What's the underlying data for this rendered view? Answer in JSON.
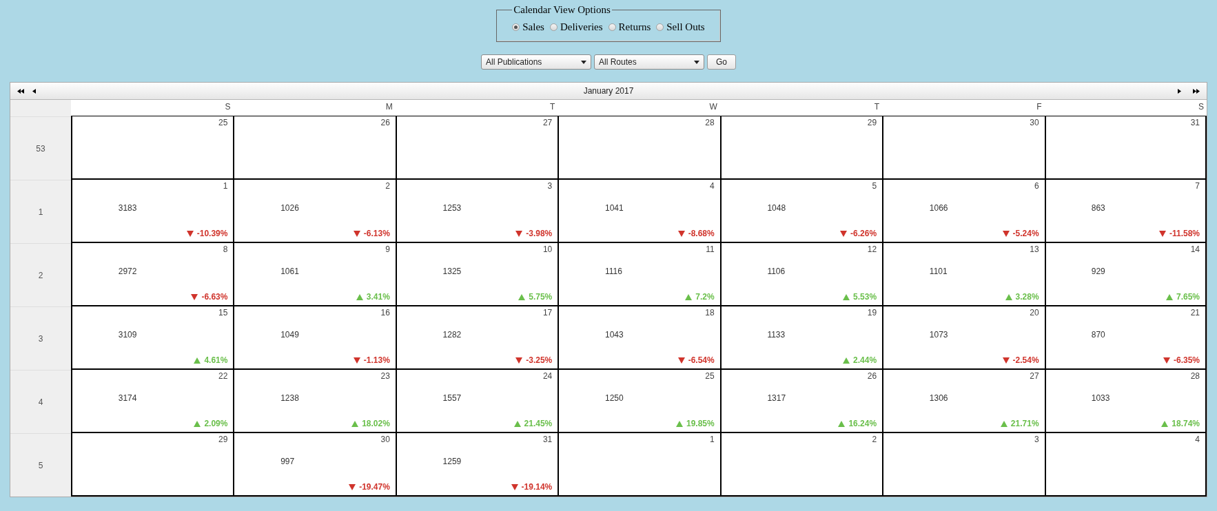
{
  "view_options": {
    "legend": "Calendar View Options",
    "options": [
      {
        "label": "Sales",
        "selected": true
      },
      {
        "label": "Deliveries",
        "selected": false
      },
      {
        "label": "Returns",
        "selected": false
      },
      {
        "label": "Sell Outs",
        "selected": false
      }
    ]
  },
  "filters": {
    "publication": "All Publications",
    "route": "All Routes",
    "go": "Go"
  },
  "calendar": {
    "title": "January 2017",
    "weekdays": [
      "S",
      "M",
      "T",
      "W",
      "T",
      "F",
      "S"
    ],
    "weeks": [
      {
        "number": "53",
        "days": [
          {
            "day": "25"
          },
          {
            "day": "26"
          },
          {
            "day": "27"
          },
          {
            "day": "28"
          },
          {
            "day": "29"
          },
          {
            "day": "30"
          },
          {
            "day": "31"
          }
        ]
      },
      {
        "number": "1",
        "days": [
          {
            "day": "1",
            "value": "3183",
            "change": "-10.39%",
            "rising": false
          },
          {
            "day": "2",
            "value": "1026",
            "change": "-6.13%",
            "rising": false
          },
          {
            "day": "3",
            "value": "1253",
            "change": "-3.98%",
            "rising": false
          },
          {
            "day": "4",
            "value": "1041",
            "change": "-8.68%",
            "rising": false
          },
          {
            "day": "5",
            "value": "1048",
            "change": "-6.26%",
            "rising": false
          },
          {
            "day": "6",
            "value": "1066",
            "change": "-5.24%",
            "rising": false
          },
          {
            "day": "7",
            "value": "863",
            "change": "-11.58%",
            "rising": false
          }
        ]
      },
      {
        "number": "2",
        "days": [
          {
            "day": "8",
            "value": "2972",
            "change": "-6.63%",
            "rising": false
          },
          {
            "day": "9",
            "value": "1061",
            "change": "3.41%",
            "rising": true
          },
          {
            "day": "10",
            "value": "1325",
            "change": "5.75%",
            "rising": true
          },
          {
            "day": "11",
            "value": "1116",
            "change": "7.2%",
            "rising": true
          },
          {
            "day": "12",
            "value": "1106",
            "change": "5.53%",
            "rising": true
          },
          {
            "day": "13",
            "value": "1101",
            "change": "3.28%",
            "rising": true
          },
          {
            "day": "14",
            "value": "929",
            "change": "7.65%",
            "rising": true
          }
        ]
      },
      {
        "number": "3",
        "days": [
          {
            "day": "15",
            "value": "3109",
            "change": "4.61%",
            "rising": true
          },
          {
            "day": "16",
            "value": "1049",
            "change": "-1.13%",
            "rising": false
          },
          {
            "day": "17",
            "value": "1282",
            "change": "-3.25%",
            "rising": false
          },
          {
            "day": "18",
            "value": "1043",
            "change": "-6.54%",
            "rising": false
          },
          {
            "day": "19",
            "value": "1133",
            "change": "2.44%",
            "rising": true
          },
          {
            "day": "20",
            "value": "1073",
            "change": "-2.54%",
            "rising": false
          },
          {
            "day": "21",
            "value": "870",
            "change": "-6.35%",
            "rising": false
          }
        ]
      },
      {
        "number": "4",
        "days": [
          {
            "day": "22",
            "value": "3174",
            "change": "2.09%",
            "rising": true
          },
          {
            "day": "23",
            "value": "1238",
            "change": "18.02%",
            "rising": true
          },
          {
            "day": "24",
            "value": "1557",
            "change": "21.45%",
            "rising": true
          },
          {
            "day": "25",
            "value": "1250",
            "change": "19.85%",
            "rising": true
          },
          {
            "day": "26",
            "value": "1317",
            "change": "16.24%",
            "rising": true
          },
          {
            "day": "27",
            "value": "1306",
            "change": "21.71%",
            "rising": true
          },
          {
            "day": "28",
            "value": "1033",
            "change": "18.74%",
            "rising": true
          }
        ]
      },
      {
        "number": "5",
        "days": [
          {
            "day": "29"
          },
          {
            "day": "30",
            "value": "997",
            "change": "-19.47%",
            "rising": false
          },
          {
            "day": "31",
            "value": "1259",
            "change": "-19.14%",
            "rising": false
          },
          {
            "day": "1"
          },
          {
            "day": "2"
          },
          {
            "day": "3"
          },
          {
            "day": "4"
          }
        ]
      }
    ]
  }
}
